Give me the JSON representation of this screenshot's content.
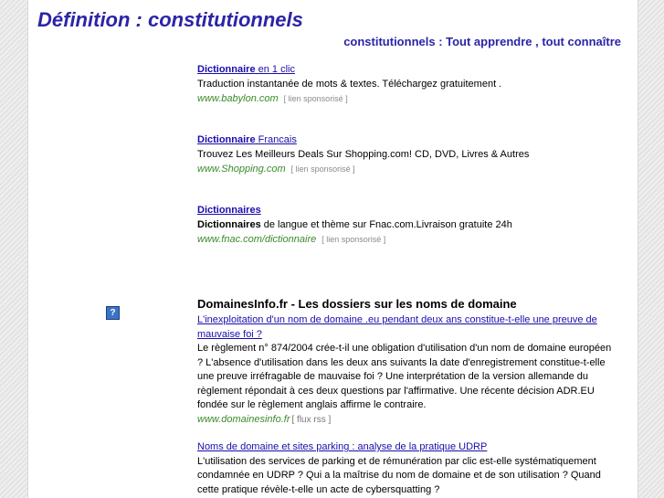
{
  "header": {
    "title": "Définition : constitutionnels",
    "tagline": "constitutionnels : Tout apprendre , tout connaître"
  },
  "ads": [
    {
      "title_bold": "Dictionnaire",
      "title_rest": " en 1 clic",
      "desc_bold": "",
      "desc_rest": "Traduction instantanée de mots & textes. Téléchargez gratuitement .",
      "url": "www.babylon.com",
      "tag": "[ lien sponsorisé ]"
    },
    {
      "title_bold": "Dictionnaire",
      "title_rest": " Francais",
      "desc_bold": "",
      "desc_rest": "Trouvez Les Meilleurs Deals Sur Shopping.com! CD, DVD, Livres & Autres",
      "url": "www.Shopping.com",
      "tag": "[ lien sponsorisé ]"
    },
    {
      "title_bold": "Dictionnaires",
      "title_rest": "",
      "desc_bold": "Dictionnaires",
      "desc_rest": " de langue et thème sur Fnac.com.Livraison gratuite 24h",
      "url": "www.fnac.com/dictionnaire",
      "tag": "[ lien sponsorisé ]"
    }
  ],
  "feed": {
    "help_icon": "?",
    "title": "DomainesInfo.fr - Les dossiers sur les noms de domaine",
    "articles": [
      {
        "link": "L'inexploitation d'un nom de domaine .eu pendant deux ans constitue-t-elle une preuve de mauvaise foi ?",
        "body": "Le règlement n° 874/2004 crée-t-il une obligation d'utilisation d'un nom de domaine européen ? L'absence d'utilisation dans les deux ans suivants la date d'enregistrement constitue-t-elle une preuve irréfragable de mauvaise foi ? Une interprétation de la version allemande du règlement répondait à ces deux questions par l'affirmative. Une récente décision ADR.EU fondée sur le règlement anglais affirme le contraire.",
        "url": "www.domainesinfo.fr",
        "rss": "[ flux rss ]"
      },
      {
        "link": "Noms de domaine et sites parking : analyse de la pratique UDRP",
        "body": "L'utilisation des services de parking et de rémunération par clic est-elle systématiquement condamnée en UDRP ? Qui a la maîtrise du nom de domaine et de son utilisation ? Quand cette pratique révèle-t-elle un acte de cybersquatting ?"
      }
    ]
  }
}
